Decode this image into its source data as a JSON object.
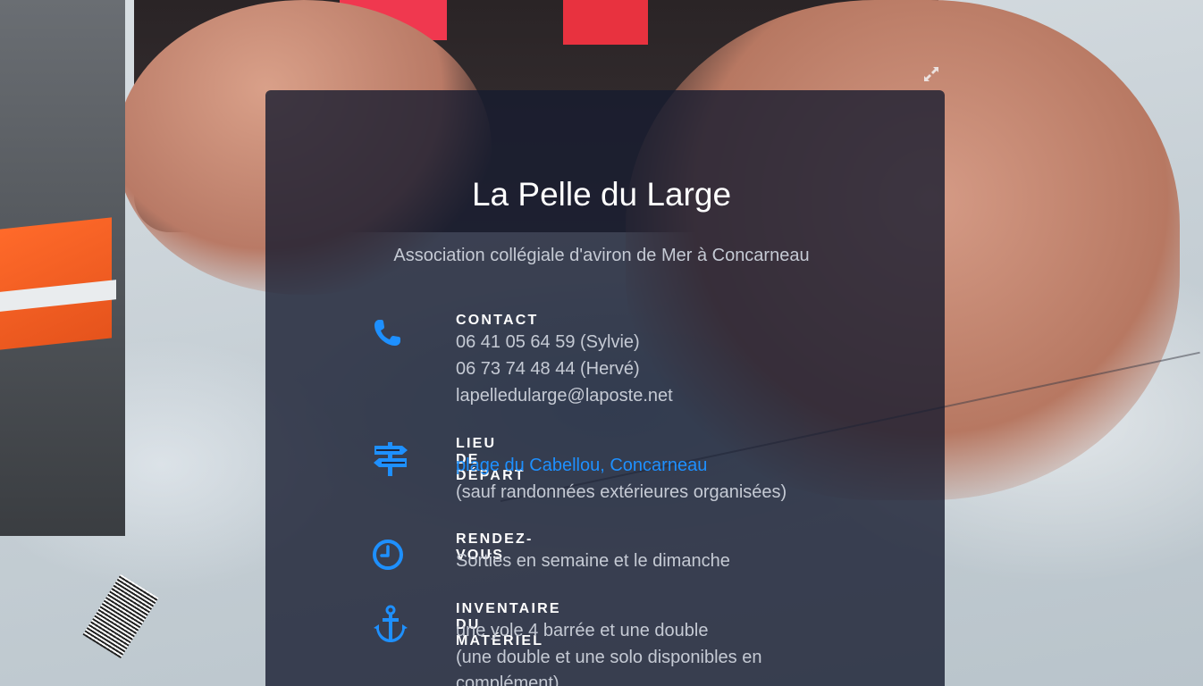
{
  "header": {
    "title": "La Pelle du Large",
    "subtitle": "Association collégiale d'aviron de Mer à Concarneau"
  },
  "accent_color": "#1e90ff",
  "sections": {
    "contact": {
      "icon": "phone-icon",
      "heading": "CONTACT",
      "phone_sylvie": "06 41 05 64 59 (Sylvie)",
      "phone_herve": "06 73 74 48 44 (Hervé)",
      "email": "lapelledularge@laposte.net"
    },
    "depart": {
      "icon": "signpost-icon",
      "heading": "LIEU DE DÉPART",
      "location_link": "plage du Cabellou, Concarneau",
      "note": "(sauf randonnées extérieures organisées)"
    },
    "rendezvous": {
      "icon": "clock-icon",
      "heading": "RENDEZ-VOUS",
      "text": "Sorties en semaine et le dimanche"
    },
    "materiel": {
      "icon": "anchor-icon",
      "heading": "INVENTAIRE DU MATÉRIEL",
      "line1": "une yole 4 barrée et une double",
      "line2": "(une double et une solo disponibles en",
      "line3": "complément)"
    }
  }
}
